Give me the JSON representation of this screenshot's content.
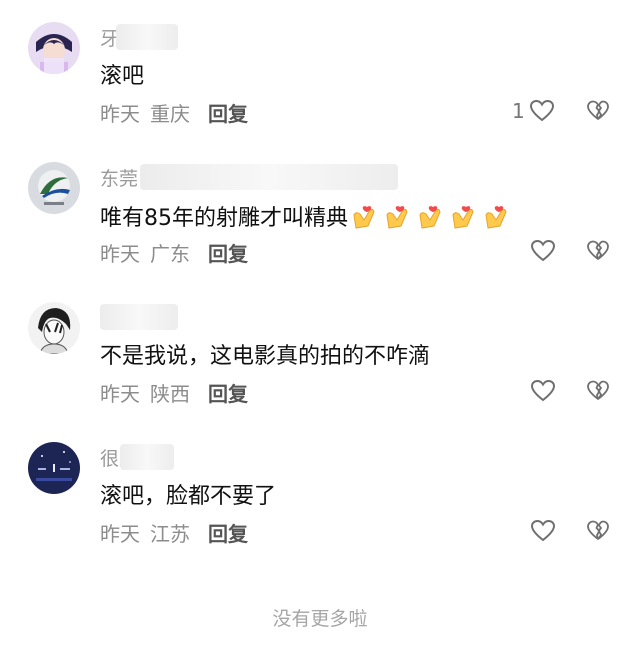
{
  "comments": [
    {
      "username": "牙",
      "content": "滚吧",
      "time": "昨天",
      "location": "重庆",
      "reply_label": "回复",
      "like_count": "1",
      "avatar": "anime-character-avatar"
    },
    {
      "username": "东莞",
      "content": "唯有85年的射雕才叫精典",
      "emoji": [
        "heart-hands-emoji",
        "heart-hands-emoji",
        "heart-hands-emoji",
        "heart-hands-emoji",
        "heart-hands-emoji"
      ],
      "time": "昨天",
      "location": "广东",
      "reply_label": "回复",
      "like_count": "",
      "avatar": "logo-avatar"
    },
    {
      "username": "",
      "content": "不是我说，这电影真的拍的不咋滴",
      "time": "昨天",
      "location": "陕西",
      "reply_label": "回复",
      "like_count": "",
      "avatar": "sketch-portrait-avatar"
    },
    {
      "username": "很",
      "content": "滚吧，脸都不要了",
      "time": "昨天",
      "location": "江苏",
      "reply_label": "回复",
      "like_count": "",
      "avatar": "night-sky-avatar"
    }
  ],
  "footer": "没有更多啦",
  "colors": {
    "text": "#111111",
    "meta": "#8c8c8c",
    "footer": "#a6a6a6"
  }
}
